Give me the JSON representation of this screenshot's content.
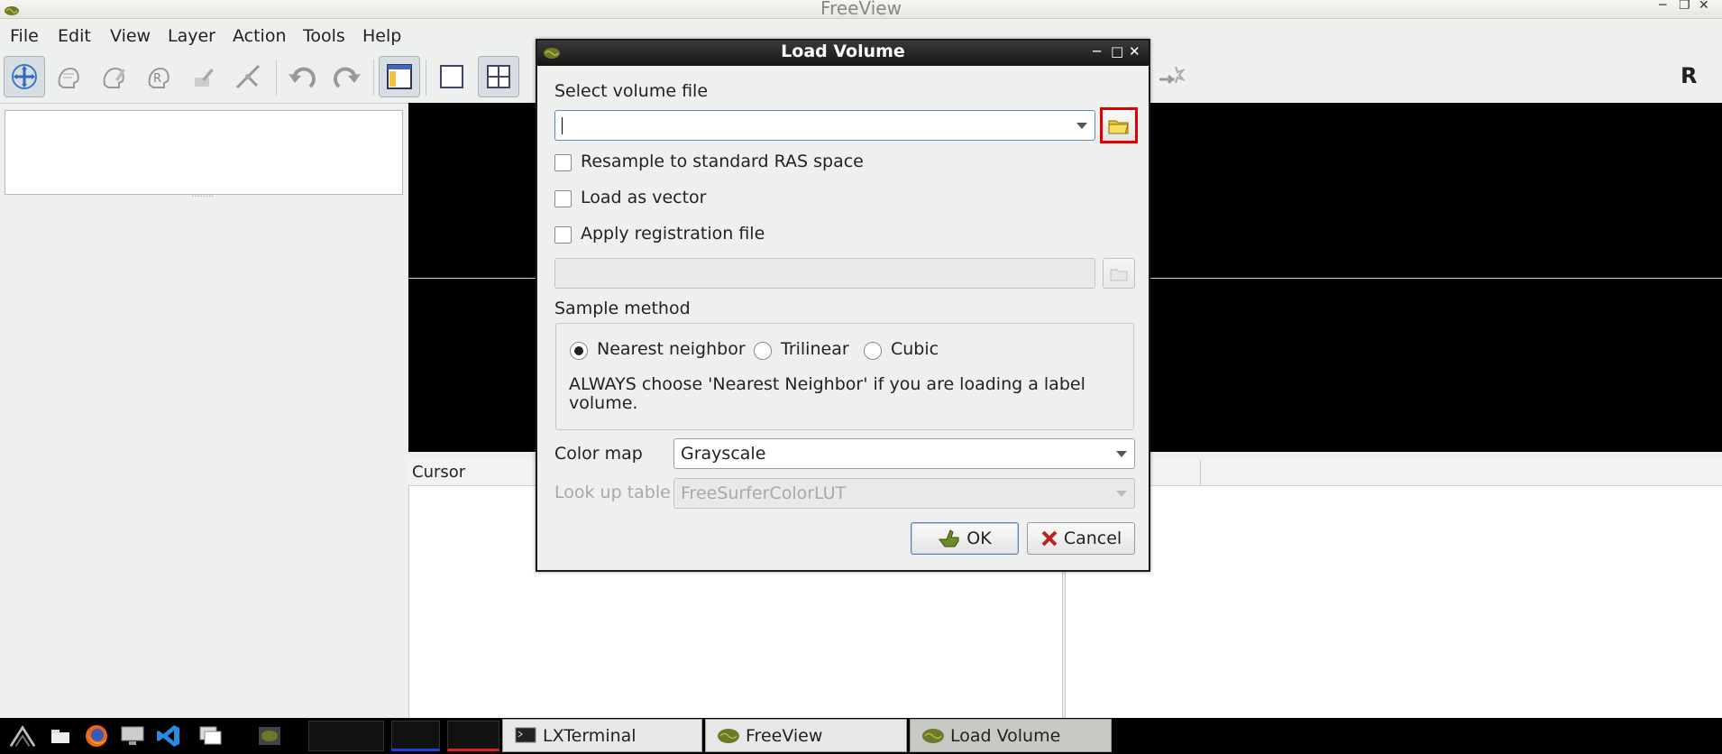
{
  "window": {
    "title": "FreeView"
  },
  "menu": [
    "File",
    "Edit",
    "View",
    "Layer",
    "Action",
    "Tools",
    "Help"
  ],
  "toolbar": {
    "buttons": [
      "navigate-icon",
      "recon-edit-icon",
      "voxel-edit-icon",
      "roi-edit-icon",
      "point-set-edit-icon",
      "contour-icon",
      "undo-icon",
      "redo-icon",
      "main-panel-icon",
      "layout-1x1-icon",
      "layout-2x2-icon"
    ],
    "right_label": "R"
  },
  "info_panel": {
    "cursor_header": "Cursor"
  },
  "taskbar": {
    "tasks": [
      {
        "label": "LXTerminal",
        "icon": "terminal-icon"
      },
      {
        "label": "FreeView",
        "icon": "brain-icon"
      },
      {
        "label": "Load Volume",
        "icon": "brain-icon",
        "active": true
      }
    ]
  },
  "dialog": {
    "title": "Load Volume",
    "select_volume_label": "Select volume file",
    "volume_file_value": "",
    "options": {
      "resample": {
        "label": "Resample to standard RAS space",
        "checked": false
      },
      "load_vector": {
        "label": "Load as vector",
        "checked": false
      },
      "apply_registration": {
        "label": "Apply registration file",
        "checked": false
      }
    },
    "registration_file_value": "",
    "sample_method": {
      "label": "Sample method",
      "options": [
        "Nearest neighbor",
        "Trilinear",
        "Cubic"
      ],
      "selected": "Nearest neighbor",
      "note": "ALWAYS choose 'Nearest Neighbor' if you are loading a label volume."
    },
    "color_map": {
      "label": "Color map",
      "value": "Grayscale"
    },
    "lookup_table": {
      "label": "Look up table",
      "value": "FreeSurferColorLUT",
      "enabled": false
    },
    "buttons": {
      "ok": "OK",
      "cancel": "Cancel"
    }
  },
  "colors": {
    "highlight": "#e00000",
    "view_bg": "#000000",
    "dialog_title_bg": "#1a1a1a"
  }
}
